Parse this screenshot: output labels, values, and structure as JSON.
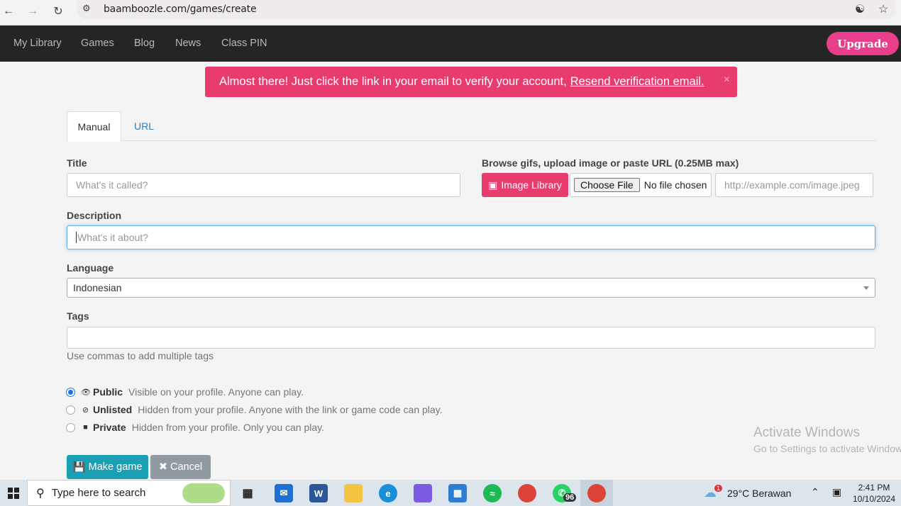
{
  "browser": {
    "url": "baamboozle.com/games/create"
  },
  "nav": {
    "items": [
      "My Library",
      "Games",
      "Blog",
      "News",
      "Class PIN"
    ],
    "upgrade_label": "Upgrade"
  },
  "alert": {
    "message": "Almost there! Just click the link in your email to verify your account,",
    "link": "Resend verification email.",
    "close": "×"
  },
  "tabs": {
    "manual": "Manual",
    "url": "URL"
  },
  "form": {
    "title_label": "Title",
    "title_placeholder": "What's it called?",
    "image_label": "Browse gifs, upload image or paste URL (0.25MB max)",
    "image_library_label": "Image Library",
    "choose_file_label": "Choose File",
    "no_file_text": "No file chosen",
    "image_url_placeholder": "http://example.com/image.jpeg",
    "description_label": "Description",
    "description_placeholder": "What's it about?",
    "language_label": "Language",
    "language_value": "Indonesian",
    "tags_label": "Tags",
    "tags_help": "Use commas to add multiple tags",
    "visibility": [
      {
        "title": "Public",
        "desc": "Visible on your profile. Anyone can play.",
        "icon": "eye-icon",
        "checked": true
      },
      {
        "title": "Unlisted",
        "desc": "Hidden from your profile. Anyone with the link or game code can play.",
        "icon": "eye-slash-icon",
        "checked": false
      },
      {
        "title": "Private",
        "desc": "Hidden from your profile. Only you can play.",
        "icon": "lock-icon",
        "checked": false
      }
    ],
    "make_game_label": "Make game",
    "cancel_label": "Cancel"
  },
  "watermark": {
    "line1": "Activate Windows",
    "line2": "Go to Settings to activate Windows."
  },
  "taskbar": {
    "search_placeholder": "Type here to search",
    "whatsapp_badge": "96",
    "weather_badge": "1",
    "weather": "29°C  Berawan",
    "time": "2:41 PM",
    "date": "10/10/2024"
  },
  "colors": {
    "accent_pink": "#e83c6e",
    "nav_bg": "#252525",
    "primary_teal": "#1a9fb5"
  }
}
